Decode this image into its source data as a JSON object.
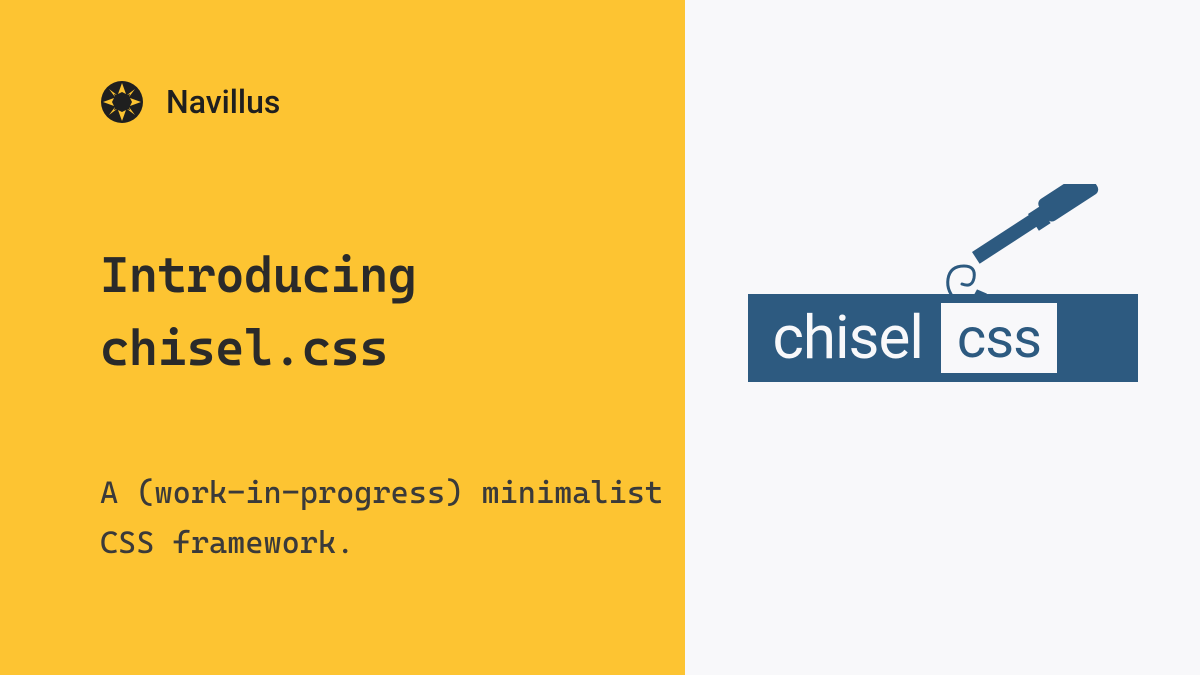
{
  "brand": {
    "name": "Navillus",
    "icon_name": "compass-arrows-icon"
  },
  "headline": "Introducing chisel.css",
  "subtitle": "A (work-in-progress) minimalist CSS framework.",
  "logo": {
    "word_left": "chisel",
    "word_right": "css",
    "tool_icon_name": "chisel-tool-icon"
  },
  "colors": {
    "accent_yellow": "#fdc432",
    "dark_blue": "#2d5a80",
    "off_white": "#f8f8fa",
    "text_dark": "#2a2a2a"
  }
}
